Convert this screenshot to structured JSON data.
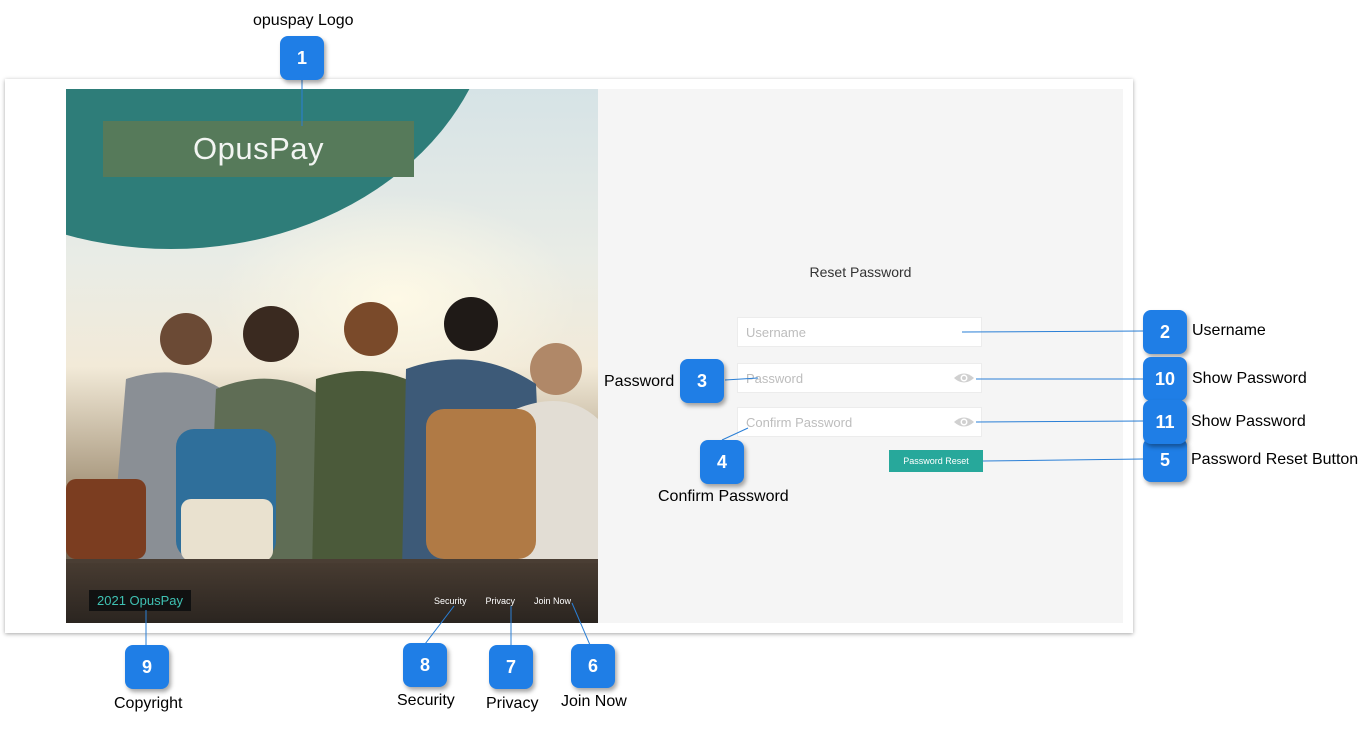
{
  "login_page": {
    "logo_text": "OpusPay",
    "copyright": "2021 OpusPay",
    "footer_links": [
      "Security",
      "Privacy",
      "Join Now"
    ],
    "form": {
      "title": "Reset Password",
      "username_placeholder": "Username",
      "password_placeholder": "Password",
      "confirm_placeholder": "Confirm Password",
      "reset_button": "Password Reset"
    },
    "accent_color": "#27a89b",
    "brand_circle_color": "#2e7d79"
  },
  "annotations": [
    {
      "number": "1",
      "label": "opuspay Logo"
    },
    {
      "number": "2",
      "label": "Username"
    },
    {
      "number": "3",
      "label": "Password"
    },
    {
      "number": "4",
      "label": "Confirm Password"
    },
    {
      "number": "5",
      "label": "Password Reset Button"
    },
    {
      "number": "6",
      "label": "Join Now"
    },
    {
      "number": "7",
      "label": "Privacy"
    },
    {
      "number": "8",
      "label": "Security"
    },
    {
      "number": "9",
      "label": "Copyright"
    },
    {
      "number": "10",
      "label": "Show Password"
    },
    {
      "number": "11",
      "label": "Show Password"
    }
  ],
  "badge_color": "#1f7ee6"
}
